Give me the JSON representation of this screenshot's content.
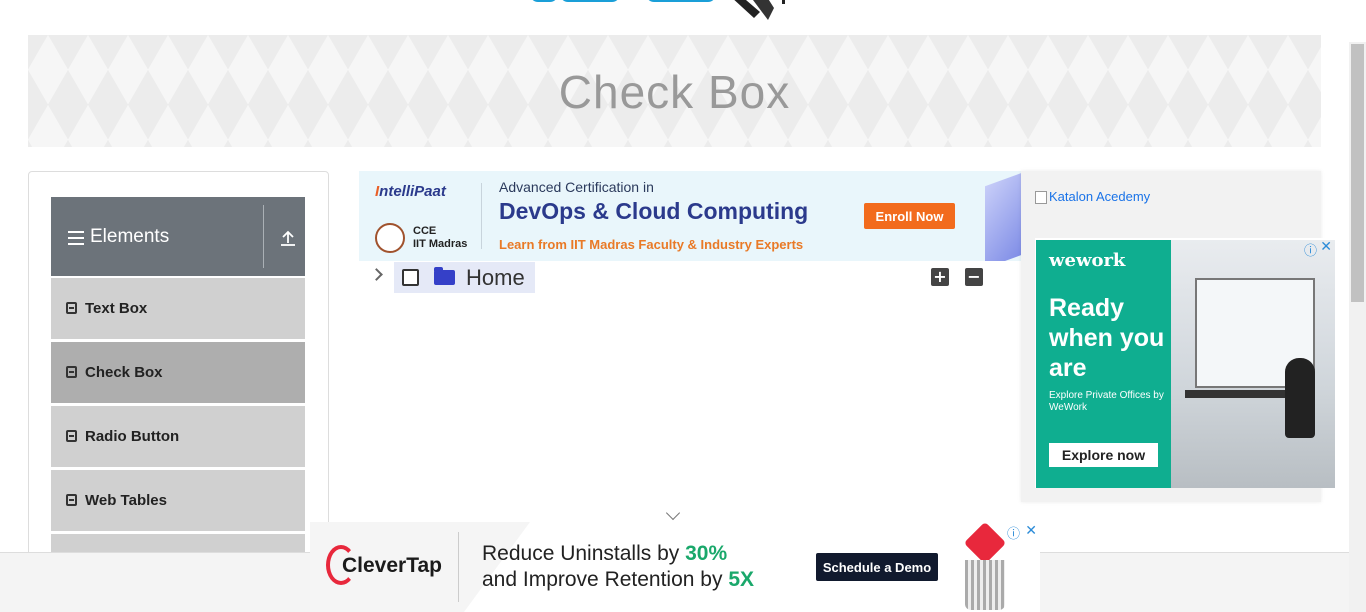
{
  "header": {
    "page_title": "Check Box"
  },
  "sidebar": {
    "group": {
      "label": "Elements"
    },
    "items": [
      {
        "label": "Text Box"
      },
      {
        "label": "Check Box",
        "active": true
      },
      {
        "label": "Radio Button"
      },
      {
        "label": "Web Tables"
      }
    ]
  },
  "ad_top": {
    "brand_a": "I",
    "brand_b": "ntelliPaat",
    "cce_line1": "CCE",
    "cce_line2": "IIT Madras",
    "line1": "Advanced Certification in",
    "line2": "DevOps & Cloud Computing",
    "line3": "Learn from IIT Madras Faculty & Industry Experts",
    "cta": "Enroll Now"
  },
  "tree": {
    "root_label": "Home",
    "expand_all": "+",
    "collapse_all": "−"
  },
  "right_ads": {
    "katalon_alt": "Katalon Acedemy",
    "wework": {
      "logo": "wework",
      "headline": "Ready when you are",
      "subline": "Explore Private Offices by WeWork",
      "cta": "Explore now",
      "adchoice": "ⓘ",
      "close": "✕"
    }
  },
  "bottom_ad": {
    "logo": "CleverTap",
    "line1_a": "Reduce Uninstalls by ",
    "line1_b": "30%",
    "line2_a": "and Improve Retention by ",
    "line2_b": "5X",
    "cta": "Schedule a Demo",
    "info": "ⓘ",
    "close": "✕"
  },
  "colors": {
    "sidebar_header": "#6c737a",
    "menu_item": "#d0d0d0",
    "menu_item_active": "#aeaeae",
    "tree_folder": "#3540c8",
    "accent_orange": "#f26b1d"
  }
}
